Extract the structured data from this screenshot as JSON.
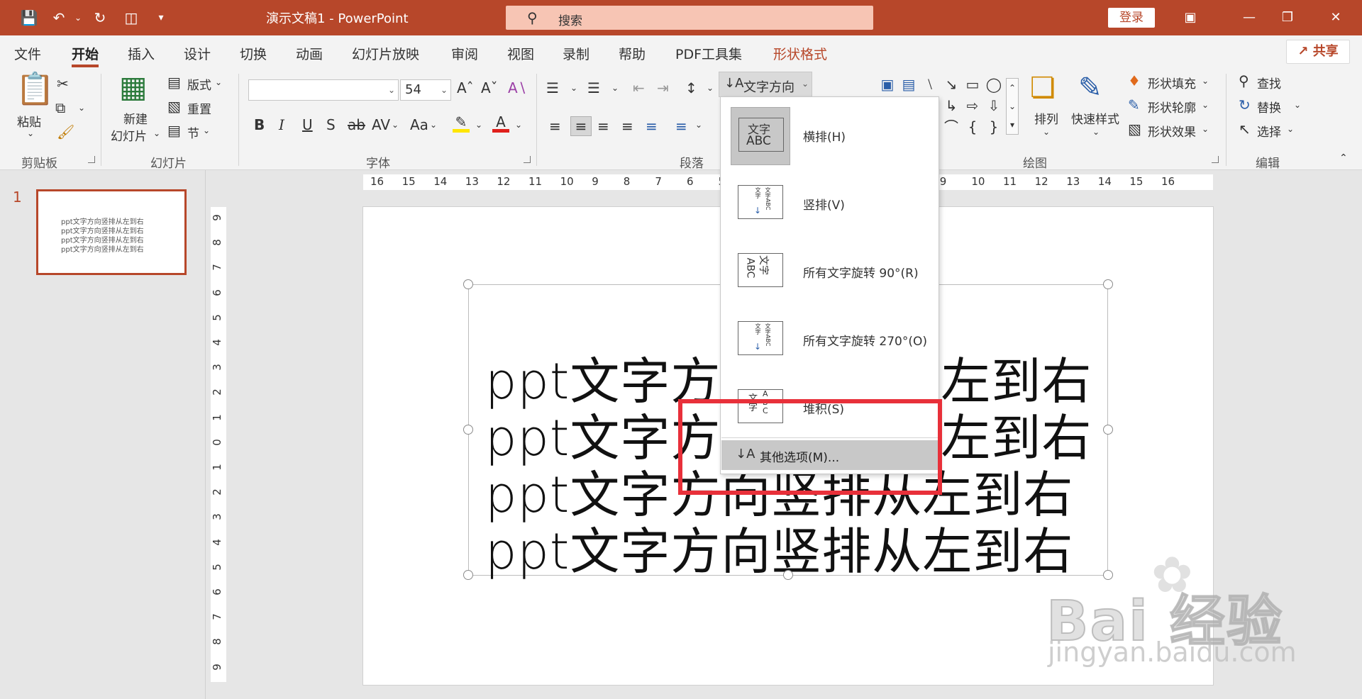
{
  "titlebar": {
    "doc_title": "演示文稿1  -  PowerPoint",
    "search_placeholder": "搜索",
    "login": "登录",
    "accent": "#b7472a"
  },
  "tabs": [
    "文件",
    "开始",
    "插入",
    "设计",
    "切换",
    "动画",
    "幻灯片放映",
    "审阅",
    "视图",
    "录制",
    "帮助",
    "PDF工具集",
    "形状格式"
  ],
  "active_tab": "开始",
  "share": "共享",
  "ribbon": {
    "clipboard": {
      "paste": "粘贴",
      "label": "剪贴板"
    },
    "slides": {
      "new_slide_1": "新建",
      "new_slide_2": "幻灯片",
      "layout": "版式",
      "reset": "重置",
      "section": "节",
      "label": "幻灯片"
    },
    "font": {
      "font_name": "",
      "font_size": "54",
      "bold": "B",
      "italic": "I",
      "underline": "U",
      "strike": "S",
      "strike2": "ab",
      "spacing": "AV",
      "case": "Aa",
      "label": "字体"
    },
    "paragraph": {
      "text_direction": "文字方向",
      "label": "段落"
    },
    "drawing": {
      "arrange": "排列",
      "quick_styles": "快速样式",
      "fill": "形状填充",
      "outline": "形状轮廓",
      "effects": "形状效果",
      "label": "绘图"
    },
    "editing": {
      "find": "查找",
      "replace": "替换",
      "select": "选择",
      "label": "编辑"
    }
  },
  "thumbnail": {
    "number": "1",
    "lines": [
      "ppt文字方向竖排从左到右",
      "ppt文字方向竖排从左到右",
      "ppt文字方向竖排从左到右",
      "ppt文字方向竖排从左到右"
    ]
  },
  "hruler_numbers": [
    "16",
    "15",
    "14",
    "13",
    "12",
    "11",
    "10",
    "9",
    "8",
    "7",
    "6",
    "5",
    "4",
    "3",
    "5",
    "6",
    "7",
    "8",
    "9",
    "10",
    "11",
    "12",
    "13",
    "14",
    "15",
    "16"
  ],
  "vruler_numbers": [
    "9",
    "8",
    "7",
    "6",
    "5",
    "4",
    "3",
    "2",
    "1",
    "0",
    "1",
    "2",
    "3",
    "4",
    "5",
    "6",
    "7",
    "8",
    "9"
  ],
  "slide": {
    "lines": [
      {
        "left": "ppt文字方",
        "right": "左到右"
      },
      {
        "left": "ppt文字方",
        "right": "左到右"
      },
      {
        "left": "ppt文字方向竖排从左到右",
        "right": ""
      },
      {
        "left": "ppt文字方向竖排从左到右",
        "right": ""
      }
    ]
  },
  "text_direction_menu": {
    "items": [
      {
        "label": "横排(H)",
        "icon_text_top": "文字",
        "icon_text_bottom": "ABC",
        "selected": true
      },
      {
        "label": "竖排(V)",
        "icon_text_top": "文字ABC",
        "icon_text_bottom": "",
        "selected": false
      },
      {
        "label": "所有文字旋转 90°(R)",
        "icon_text_top": "文字",
        "icon_text_bottom": "ABC",
        "selected": false
      },
      {
        "label": "所有文字旋转 270°(O)",
        "icon_text_top": "文字ABC",
        "icon_text_bottom": "",
        "selected": false
      },
      {
        "label": "堆积(S)",
        "icon_text_top": "文字",
        "icon_text_bottom": "ABC",
        "selected": false
      }
    ],
    "more_options": "其他选项(M)..."
  },
  "watermark": {
    "main": "Bai 经验",
    "sub": "jingyan.baidu.com"
  },
  "annotation_color": "#e8303a"
}
